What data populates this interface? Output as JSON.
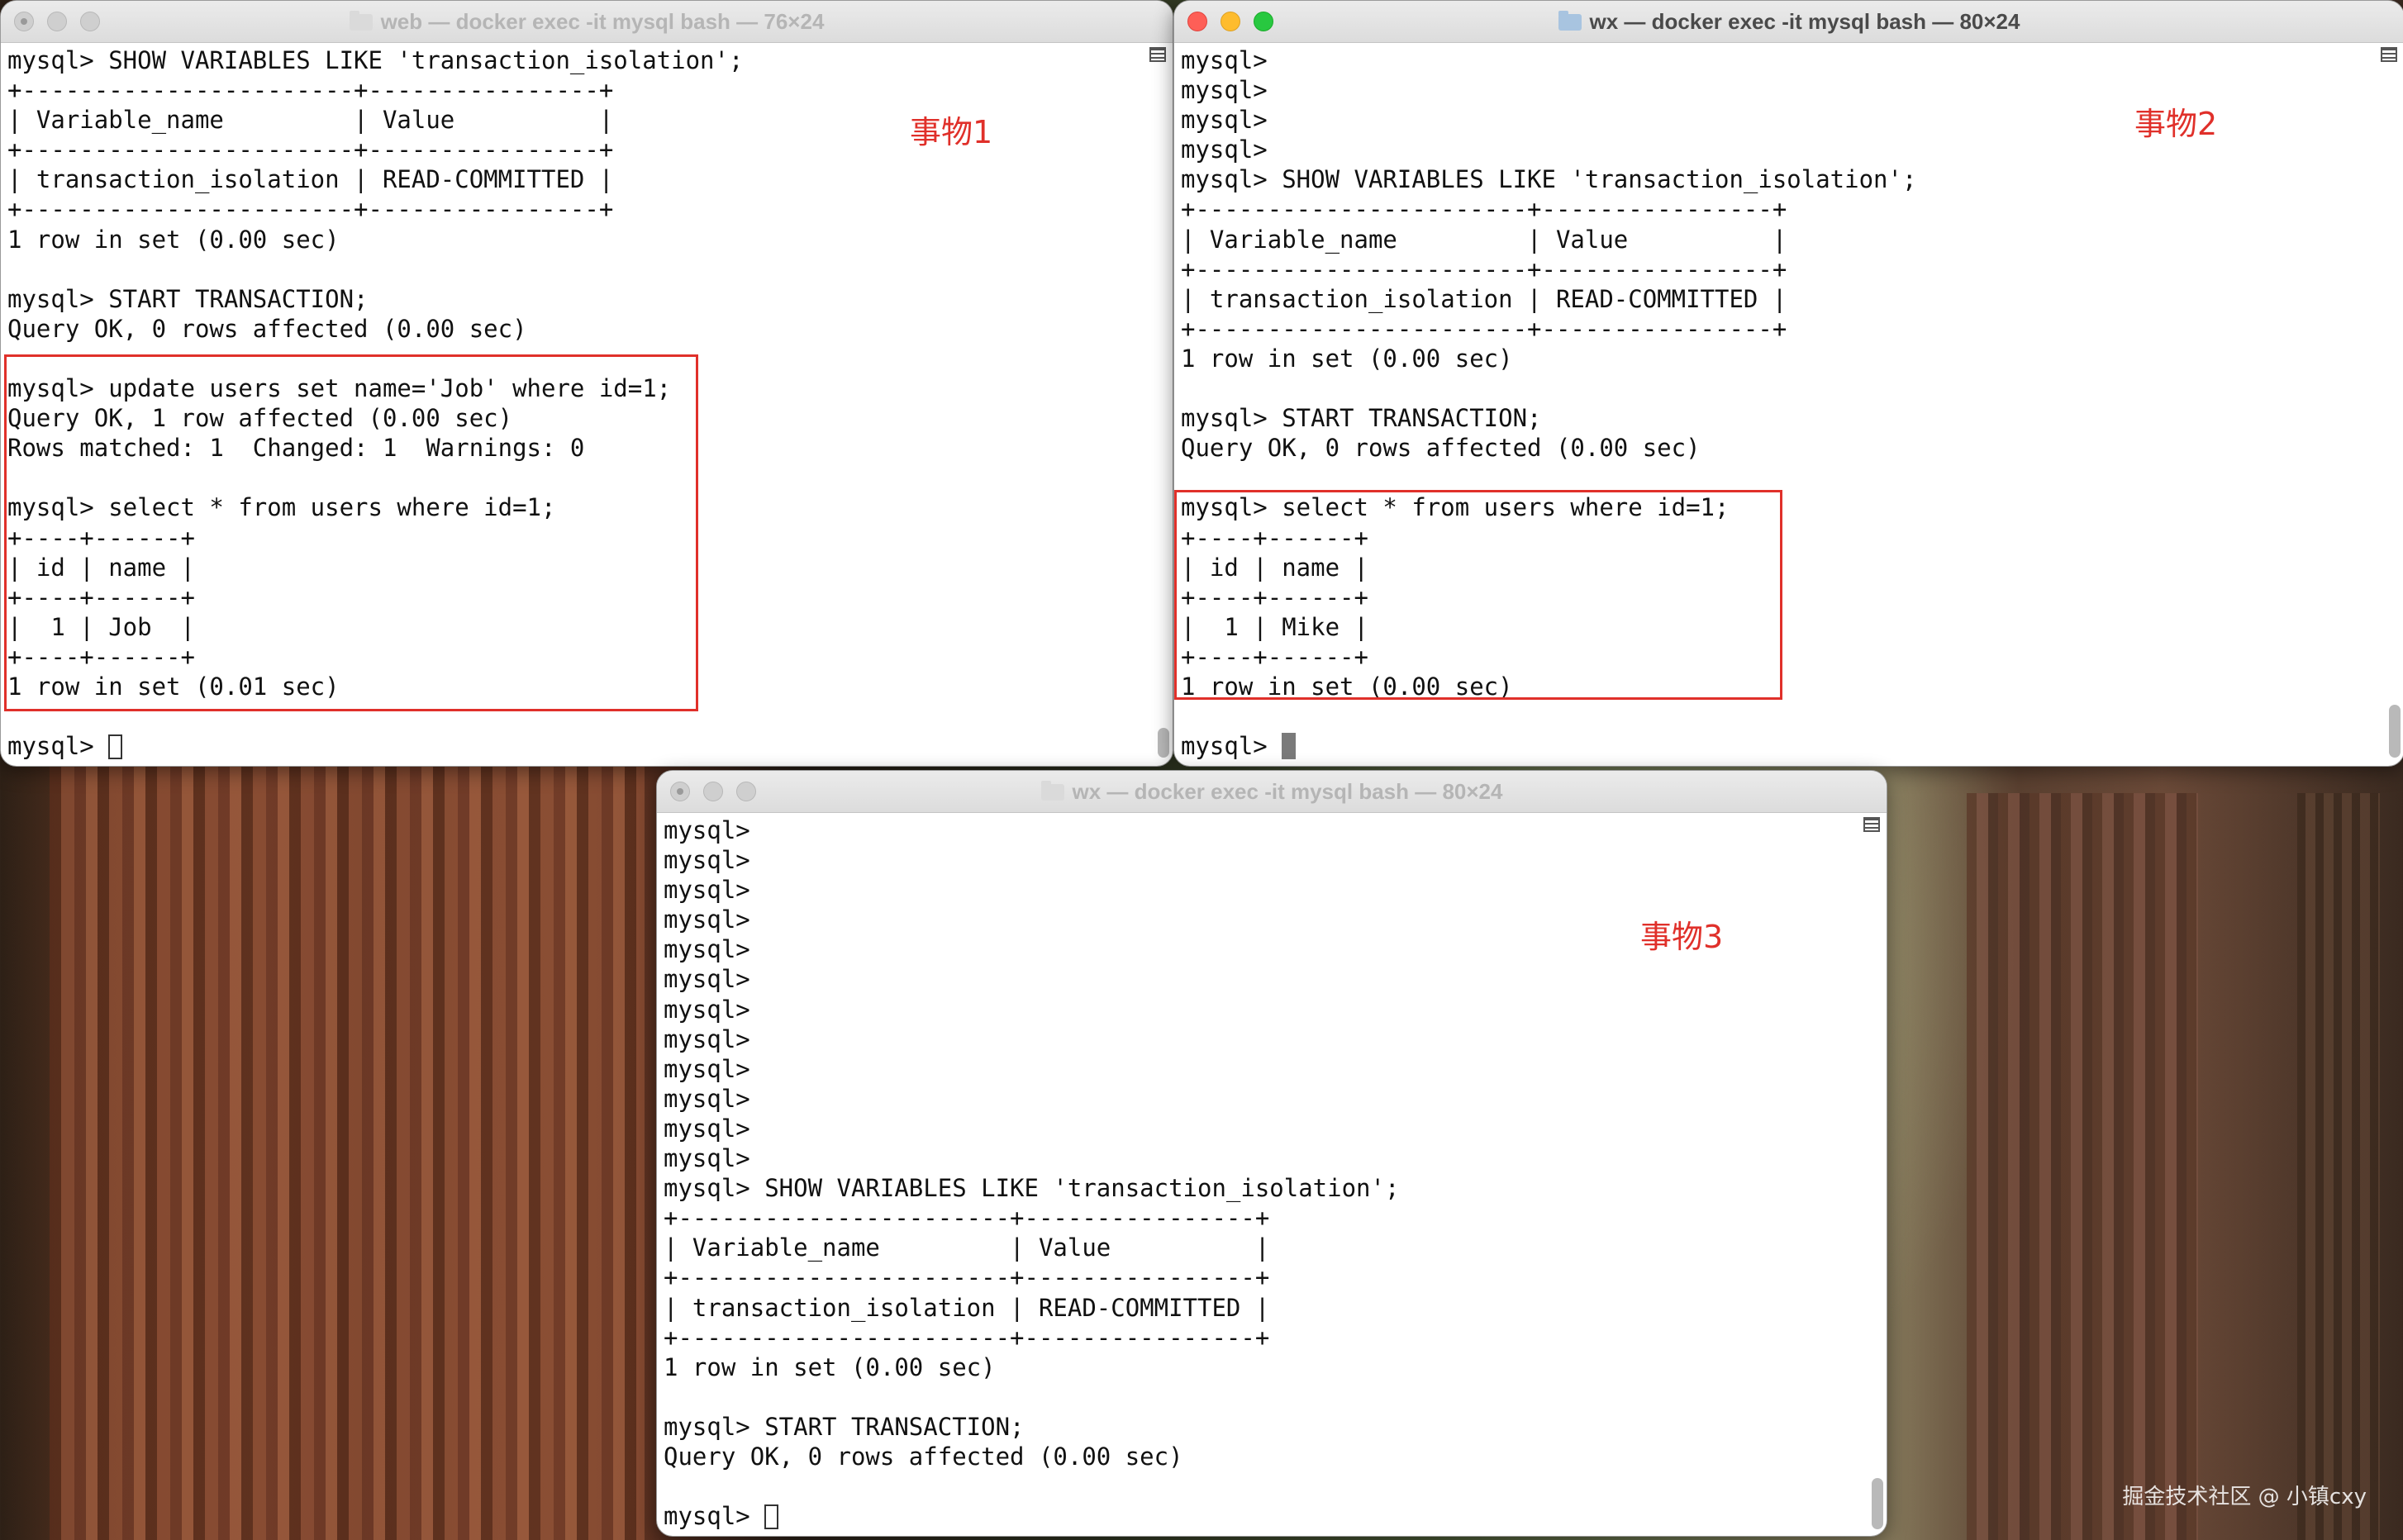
{
  "desktop": {
    "watermark": "掘金技术社区 @ 小镇cxy"
  },
  "windows": [
    {
      "id": "web",
      "title": "web — docker exec -it mysql bash — 76×24",
      "annotation": "事物1",
      "lines": [
        "mysql> SHOW VARIABLES LIKE 'transaction_isolation';",
        "+-----------------------+----------------+",
        "| Variable_name         | Value          |",
        "+-----------------------+----------------+",
        "| transaction_isolation | READ-COMMITTED |",
        "+-----------------------+----------------+",
        "1 row in set (0.00 sec)",
        "",
        "mysql> START TRANSACTION;",
        "Query OK, 0 rows affected (0.00 sec)",
        "",
        "mysql> update users set name='Job' where id=1;",
        "Query OK, 1 row affected (0.00 sec)",
        "Rows matched: 1  Changed: 1  Warnings: 0",
        "",
        "mysql> select * from users where id=1;",
        "+----+------+",
        "| id | name |",
        "+----+------+",
        "|  1 | Job  |",
        "+----+------+",
        "1 row in set (0.01 sec)",
        ""
      ],
      "prompt": "mysql> "
    },
    {
      "id": "wx1",
      "title": "wx — docker exec -it mysql bash — 80×24",
      "annotation": "事物2",
      "lines": [
        "mysql>",
        "mysql>",
        "mysql>",
        "mysql>",
        "mysql> SHOW VARIABLES LIKE 'transaction_isolation';",
        "+-----------------------+----------------+",
        "| Variable_name         | Value          |",
        "+-----------------------+----------------+",
        "| transaction_isolation | READ-COMMITTED |",
        "+-----------------------+----------------+",
        "1 row in set (0.00 sec)",
        "",
        "mysql> START TRANSACTION;",
        "Query OK, 0 rows affected (0.00 sec)",
        "",
        "mysql> select * from users where id=1;",
        "+----+------+",
        "| id | name |",
        "+----+------+",
        "|  1 | Mike |",
        "+----+------+",
        "1 row in set (0.00 sec)",
        ""
      ],
      "prompt": "mysql> "
    },
    {
      "id": "wx2",
      "title": "wx — docker exec -it mysql bash — 80×24",
      "annotation": "事物3",
      "lines": [
        "mysql>",
        "mysql>",
        "mysql>",
        "mysql>",
        "mysql>",
        "mysql>",
        "mysql>",
        "mysql>",
        "mysql>",
        "mysql>",
        "mysql>",
        "mysql>",
        "mysql> SHOW VARIABLES LIKE 'transaction_isolation';",
        "+-----------------------+----------------+",
        "| Variable_name         | Value          |",
        "+-----------------------+----------------+",
        "| transaction_isolation | READ-COMMITTED |",
        "+-----------------------+----------------+",
        "1 row in set (0.00 sec)",
        "",
        "mysql> START TRANSACTION;",
        "Query OK, 0 rows affected (0.00 sec)",
        ""
      ],
      "prompt": "mysql> "
    }
  ]
}
